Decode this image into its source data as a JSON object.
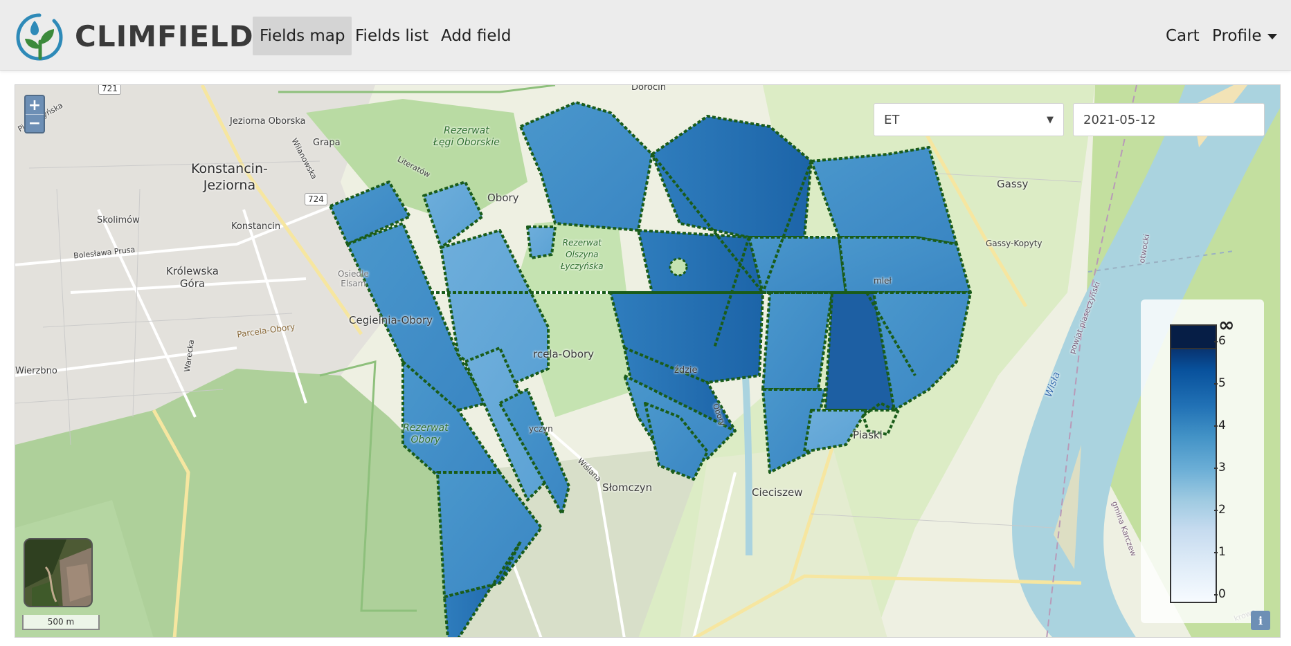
{
  "brand": {
    "name": "CLIMFIELD"
  },
  "nav": {
    "left": [
      {
        "label": "Fields map",
        "active": true
      },
      {
        "label": "Fields list",
        "active": false
      },
      {
        "label": "Add field",
        "active": false
      }
    ],
    "cart": "Cart",
    "profile": "Profile"
  },
  "map": {
    "controls": {
      "zoom_in": "+",
      "zoom_out": "−"
    },
    "layer_select": {
      "value": "ET"
    },
    "date": {
      "value": "2021-05-12"
    },
    "scale_label": "500 m",
    "legend": {
      "colormap": "Blues",
      "overflow_label": "∞",
      "ticks": [
        "0",
        "1",
        "2",
        "3",
        "4",
        "5",
        "6"
      ]
    },
    "labels": {
      "dorocin": "Dorocin",
      "jeziorna_oborska": "Jeziorna Oborska",
      "grapa": "Grapa",
      "konstancin_jeziorna": "Konstancin-\nJeziorna",
      "skolimow": "Skolimów",
      "konstancin": "Konstancin",
      "bolesawa_prusa": "Bolesława Prusa",
      "krolewska_gora": "Królewska\nGóra",
      "osiedle_elsam": "Osiedle\nElsam",
      "cegielnia_obory": "Cegielnia-Obory",
      "parcela_obory_rd": "Parcela-Obory",
      "wierzbno": "Wierzbno",
      "warecka": "Warecka",
      "piaseczynska": "Piaseczyńska",
      "wilanowska": "Wilanowska",
      "literatow": "Literatów",
      "obory": "Obory",
      "rezerwat_legi": "Rezerwat\nŁęgi Oborskie",
      "rezerwat_olszyna": "Rezerwat\nOlszyna\nŁyczyńska",
      "rezerwat_obory": "Rezerwat\nObory",
      "parcela_obory": "rcela-Obory",
      "zdzie": "ździe",
      "obory_rd": "Obory",
      "lyczyn": "yczyn",
      "wislana": "Wiślana",
      "slomczyn": "Słomczyn",
      "cieciszew": "Cieciszew",
      "piaski": "Piaski",
      "gassy": "Gassy",
      "gassy_kopyty": "Gassy-Kopyty",
      "wisla": "Wisła",
      "powsinskie": "powsinsk",
      "piaseczynski": "powiat piaseczyński",
      "gmina_karczew": "gmina Karczew",
      "otwocki": "otwocki",
      "mleko": "mleł",
      "krowa": "krowa",
      "road_721": "721",
      "road_724": "724"
    }
  }
}
